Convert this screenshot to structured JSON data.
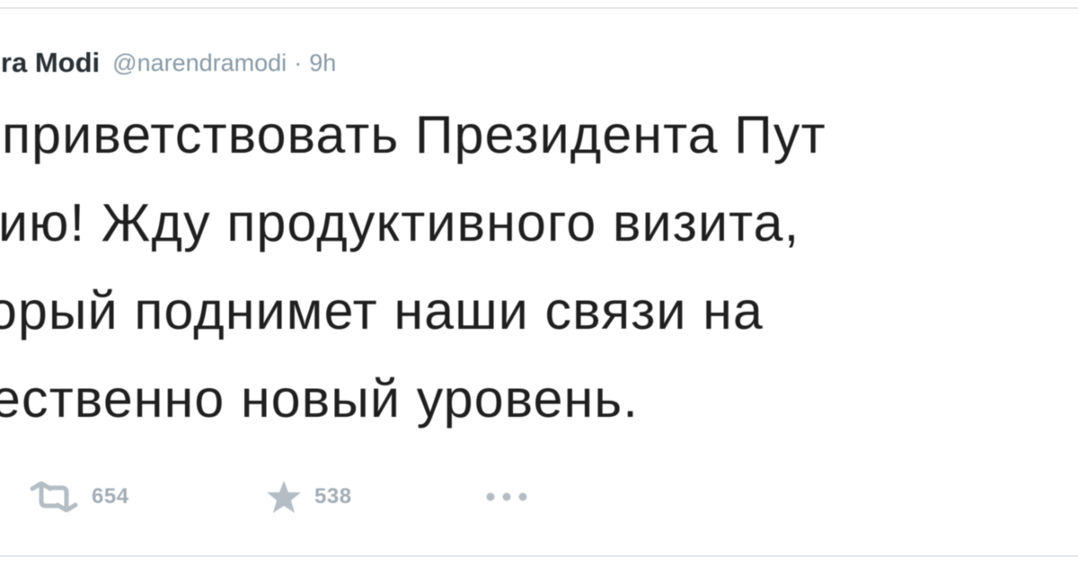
{
  "tweet": {
    "author": {
      "display_name": "dra Modi",
      "screen_name": "@narendramodi",
      "separator": "·",
      "timestamp": "9h"
    },
    "text_lines": [
      "приветствовать Президента Пут",
      "ию!  Жду продуктивного визита,",
      "орый поднимет наши связи на",
      "ественно новый уровень."
    ],
    "actions": {
      "retweet": {
        "icon": "retweet-icon",
        "count": "654"
      },
      "favorite": {
        "icon": "star-icon",
        "count": "538"
      },
      "more": {
        "icon": "more-dots-icon"
      }
    },
    "colors": {
      "text": "#1f1f1f",
      "name": "#292f33",
      "muted": "#8899a6",
      "icon": "#b4bdc4",
      "divider": "#e4e8eb"
    }
  }
}
